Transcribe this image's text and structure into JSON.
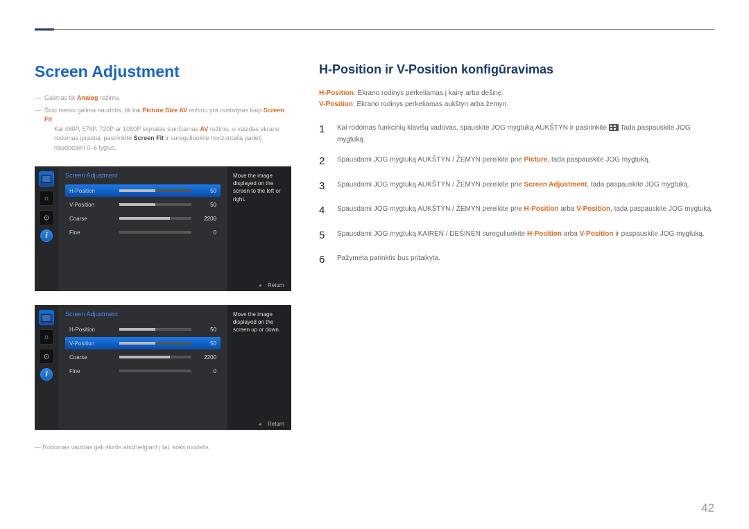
{
  "page": {
    "number": "42"
  },
  "left": {
    "heading": "Screen Adjustment",
    "note1_a": "Galimas tik ",
    "note1_hl": "Analog",
    "note1_b": " režimu.",
    "note2_a": "Šiuo meniu galima naudotis, tik kai ",
    "note2_hl1": "Picture Size AV",
    "note2_b": " režimu yra nustatytas kaip ",
    "note2_hl2": "Screen Fit",
    "note2_c": ".",
    "note2_sub_a": "Kai 480P, 576P, 720P ar 1080P signalas siunčiamas ",
    "note2_sub_hl": "AV",
    "note2_sub_b": " režimu, o vaizdas ekrane rodomas įprastai, pasirinkite ",
    "note2_sub_hl2": "Screen Fit",
    "note2_sub_c": " ir sureguliuokite horizontalią padėtį naudodami 0–6 lygius.",
    "bottom_note": "Rodomas vaizdas gali skirtis atsižvelgiant į tai, koks modelis."
  },
  "osd1": {
    "title": "Screen Adjustment",
    "rows": [
      {
        "label": "H-Position",
        "val": "50",
        "fill": 50,
        "selected": true
      },
      {
        "label": "V-Position",
        "val": "50",
        "fill": 50,
        "selected": false
      },
      {
        "label": "Coarse",
        "val": "2200",
        "fill": 70,
        "selected": false
      },
      {
        "label": "Fine",
        "val": "0",
        "fill": 0,
        "selected": false
      }
    ],
    "help": "Move the image displayed on the screen to the left or right.",
    "return": "Return"
  },
  "osd2": {
    "title": "Screen Adjustment",
    "rows": [
      {
        "label": "H-Position",
        "val": "50",
        "fill": 50,
        "selected": false
      },
      {
        "label": "V-Position",
        "val": "50",
        "fill": 50,
        "selected": true
      },
      {
        "label": "Coarse",
        "val": "2200",
        "fill": 70,
        "selected": false
      },
      {
        "label": "Fine",
        "val": "0",
        "fill": 0,
        "selected": false
      }
    ],
    "help": "Move the image displayed on the screen up or down.",
    "return": "Return"
  },
  "right": {
    "heading": "H-Position ir V-Position konfigūravimas",
    "def1_hl": "H-Position",
    "def1_txt": ": Ekrano rodinys perkeliamas į kairę arba dešinę.",
    "def2_hl": "V-Position",
    "def2_txt": ": Ekrano rodinys perkeliamas aukštyn arba žemyn.",
    "steps": {
      "s1_a": "Kai rodomas funkcinių klavišų vadovas, spauskite JOG mygtuką AUKŠTYN ir pasirinkite ",
      "s1_b": " Tada paspauskite JOG mygtuką.",
      "s2_a": "Spausdami JOG mygtuką AUKŠTYN / ŽEMYN pereikite prie ",
      "s2_hl": "Picture",
      "s2_b": ", tada paspauskite JOG mygtuką.",
      "s3_a": "Spausdami JOG mygtuką AUKŠTYN / ŽEMYN pereikite prie ",
      "s3_hl": "Screen Adjustment",
      "s3_b": ", tada paspauskite JOG mygtuką.",
      "s4_a": "Spausdami JOG mygtuką AUKŠTYN / ŽEMYN pereikite prie ",
      "s4_hl1": "H-Position",
      "s4_mid": " arba ",
      "s4_hl2": "V-Position",
      "s4_b": ", tada paspauskite JOG mygtuką.",
      "s5_a": "Spausdami JOG mygtuką KAIRĖN / DEŠINĖN sureguliuokite ",
      "s5_hl1": "H-Position",
      "s5_mid": " arba ",
      "s5_hl2": "V-Position",
      "s5_b": " ir paspauskite JOG mygtuką.",
      "s6": "Pažymėta parinktis bus pritaikyta."
    },
    "nums": {
      "n1": "1",
      "n2": "2",
      "n3": "3",
      "n4": "4",
      "n5": "5",
      "n6": "6"
    }
  }
}
